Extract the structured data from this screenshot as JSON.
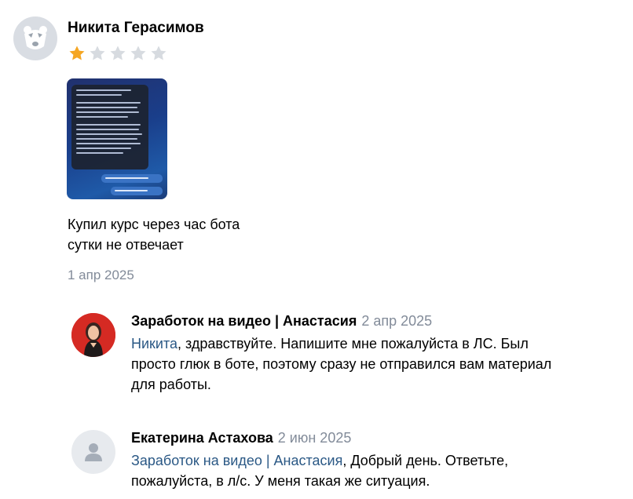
{
  "review": {
    "author": "Никита Герасимов",
    "rating": 1,
    "rating_max": 5,
    "star_color": "#f5a623",
    "star_empty_color": "#d7dbe0",
    "text_line1": "Купил курс через час бота",
    "text_line2": "сутки не отвечает",
    "date": "1 апр 2025"
  },
  "replies": [
    {
      "author": "Заработок на видео | Анастасия",
      "date": "2 апр 2025",
      "mention": "Никита",
      "text_lines": [
        ", здравствуйте. Напишите мне пожалуйста в ЛС. Был",
        "просто глюк в боте, поэтому сразу не отправился вам материал",
        "для работы."
      ]
    },
    {
      "author": "Екатерина Астахова",
      "date": "2 июн 2025",
      "mention": "Заработок на видео | Анастасия",
      "text_lines": [
        ", Добрый день. Ответьте,",
        "пожалуйста, в л/с. У меня такая же ситуация."
      ]
    }
  ],
  "icons": {
    "author_avatar": "bear-avatar-icon",
    "star": "star-icon",
    "default_avatar": "user-silhouette-icon"
  },
  "colors": {
    "link": "#2a5885",
    "muted": "#828b99"
  }
}
